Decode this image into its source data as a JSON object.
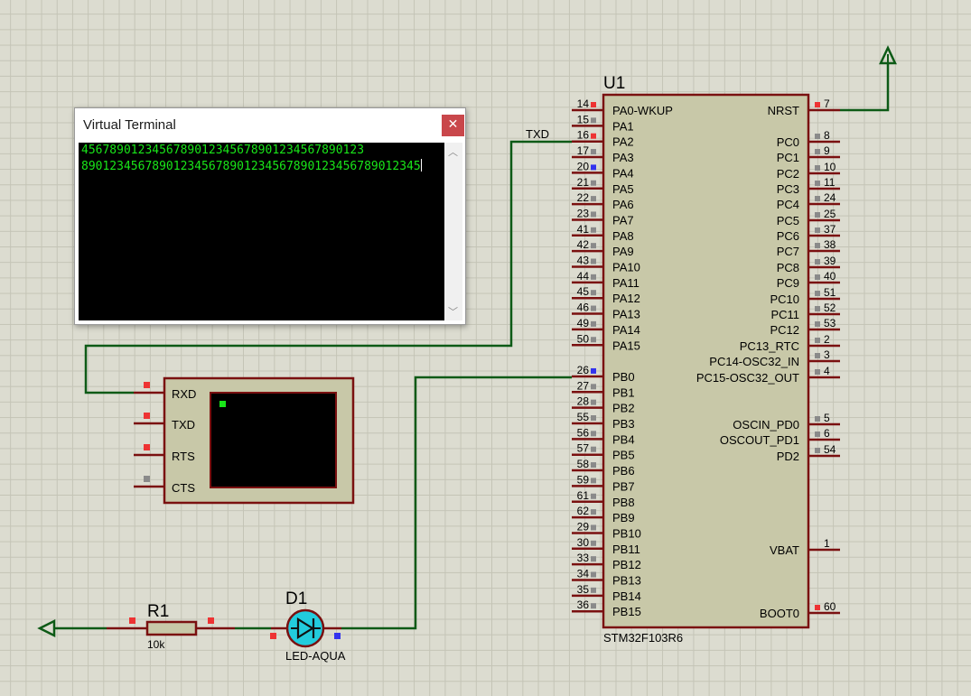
{
  "terminal_window": {
    "title": "Virtual Terminal",
    "close_icon": "close-icon",
    "lines": [
      "4567890123456789012345678901234567890123",
      "890123456789012345678901234567890123456789012345"
    ]
  },
  "mcu": {
    "ref": "U1",
    "part": "STM32F103R6",
    "left_pins": [
      {
        "num": "14",
        "name": "PA0-WKUP",
        "marker": "red"
      },
      {
        "num": "15",
        "name": "PA1",
        "marker": "grey"
      },
      {
        "num": "16",
        "name": "PA2",
        "marker": "red"
      },
      {
        "num": "17",
        "name": "PA3",
        "marker": "grey"
      },
      {
        "num": "20",
        "name": "PA4",
        "marker": "blue"
      },
      {
        "num": "21",
        "name": "PA5",
        "marker": "grey"
      },
      {
        "num": "22",
        "name": "PA6",
        "marker": "grey"
      },
      {
        "num": "23",
        "name": "PA7",
        "marker": "grey"
      },
      {
        "num": "41",
        "name": "PA8",
        "marker": "grey"
      },
      {
        "num": "42",
        "name": "PA9",
        "marker": "grey"
      },
      {
        "num": "43",
        "name": "PA10",
        "marker": "grey"
      },
      {
        "num": "44",
        "name": "PA11",
        "marker": "grey"
      },
      {
        "num": "45",
        "name": "PA12",
        "marker": "grey"
      },
      {
        "num": "46",
        "name": "PA13",
        "marker": "grey"
      },
      {
        "num": "49",
        "name": "PA14",
        "marker": "grey"
      },
      {
        "num": "50",
        "name": "PA15",
        "marker": "grey"
      },
      {
        "num": "",
        "name": "",
        "marker": "none"
      },
      {
        "num": "26",
        "name": "PB0",
        "marker": "blue"
      },
      {
        "num": "27",
        "name": "PB1",
        "marker": "grey"
      },
      {
        "num": "28",
        "name": "PB2",
        "marker": "grey"
      },
      {
        "num": "55",
        "name": "PB3",
        "marker": "grey"
      },
      {
        "num": "56",
        "name": "PB4",
        "marker": "grey"
      },
      {
        "num": "57",
        "name": "PB5",
        "marker": "grey"
      },
      {
        "num": "58",
        "name": "PB6",
        "marker": "grey"
      },
      {
        "num": "59",
        "name": "PB7",
        "marker": "grey"
      },
      {
        "num": "61",
        "name": "PB8",
        "marker": "grey"
      },
      {
        "num": "62",
        "name": "PB9",
        "marker": "grey"
      },
      {
        "num": "29",
        "name": "PB10",
        "marker": "grey"
      },
      {
        "num": "30",
        "name": "PB11",
        "marker": "grey"
      },
      {
        "num": "33",
        "name": "PB12",
        "marker": "grey"
      },
      {
        "num": "34",
        "name": "PB13",
        "marker": "grey"
      },
      {
        "num": "35",
        "name": "PB14",
        "marker": "grey"
      },
      {
        "num": "36",
        "name": "PB15",
        "marker": "grey"
      }
    ],
    "right_pins": [
      {
        "num": "7",
        "name": "NRST",
        "marker": "red"
      },
      {
        "num": "8",
        "name": "PC0",
        "marker": "grey"
      },
      {
        "num": "9",
        "name": "PC1",
        "marker": "grey"
      },
      {
        "num": "10",
        "name": "PC2",
        "marker": "grey"
      },
      {
        "num": "11",
        "name": "PC3",
        "marker": "grey"
      },
      {
        "num": "24",
        "name": "PC4",
        "marker": "grey"
      },
      {
        "num": "25",
        "name": "PC5",
        "marker": "grey"
      },
      {
        "num": "37",
        "name": "PC6",
        "marker": "grey"
      },
      {
        "num": "38",
        "name": "PC7",
        "marker": "grey"
      },
      {
        "num": "39",
        "name": "PC8",
        "marker": "grey"
      },
      {
        "num": "40",
        "name": "PC9",
        "marker": "grey"
      },
      {
        "num": "51",
        "name": "PC10",
        "marker": "grey"
      },
      {
        "num": "52",
        "name": "PC11",
        "marker": "grey"
      },
      {
        "num": "53",
        "name": "PC12",
        "marker": "grey"
      },
      {
        "num": "2",
        "name": "PC13_RTC",
        "marker": "grey"
      },
      {
        "num": "3",
        "name": "PC14-OSC32_IN",
        "marker": "grey"
      },
      {
        "num": "4",
        "name": "PC15-OSC32_OUT",
        "marker": "grey"
      },
      {
        "num": "5",
        "name": "OSCIN_PD0",
        "marker": "grey"
      },
      {
        "num": "6",
        "name": "OSCOUT_PD1",
        "marker": "grey"
      },
      {
        "num": "54",
        "name": "PD2",
        "marker": "grey"
      },
      {
        "num": "1",
        "name": "VBAT",
        "marker": "none"
      },
      {
        "num": "60",
        "name": "BOOT0",
        "marker": "red"
      }
    ]
  },
  "net_label": "TXD",
  "vterm_device": {
    "pins": [
      {
        "name": "RXD",
        "marker": "red"
      },
      {
        "name": "TXD",
        "marker": "red"
      },
      {
        "name": "RTS",
        "marker": "red"
      },
      {
        "name": "CTS",
        "marker": "grey"
      }
    ]
  },
  "resistor": {
    "ref": "R1",
    "value": "10k"
  },
  "led": {
    "ref": "D1",
    "value": "LED-AQUA"
  },
  "colors": {
    "wire": "#0d5a16",
    "component_border": "#7a1010",
    "component_fill": "#c8c8a8",
    "pin_red": "#ee3333",
    "pin_grey": "#8a8a8a",
    "pin_blue": "#3333ee",
    "terminal_text": "#19e619",
    "led_fill": "#22ccdd"
  }
}
